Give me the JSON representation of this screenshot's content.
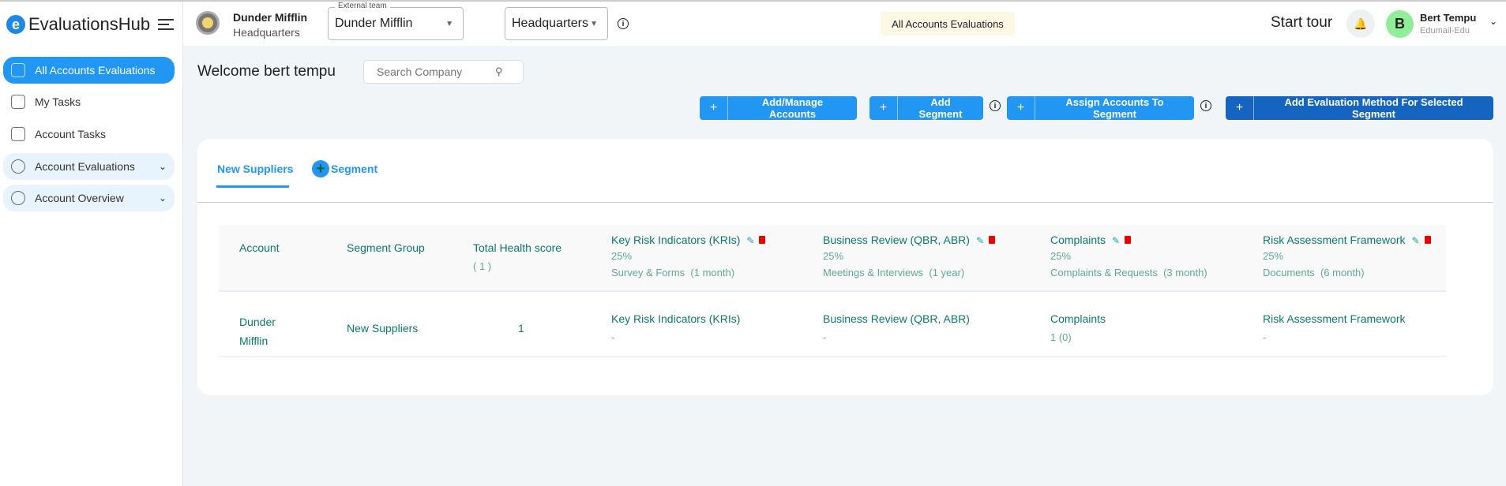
{
  "app": {
    "name": "EvaluationsHub"
  },
  "sidebar": {
    "items": [
      {
        "label": "All Accounts Evaluations"
      },
      {
        "label": "My Tasks"
      },
      {
        "label": "Account Tasks"
      },
      {
        "label": "Account Evaluations"
      },
      {
        "label": "Account Overview"
      }
    ]
  },
  "header": {
    "company": "Dunder Mifflin",
    "location": "Headquarters",
    "team_legend": "External team",
    "team_value": "Dunder Mifflin",
    "branch_value": "Headquarters",
    "badge": "All Accounts Evaluations",
    "start_tour": "Start tour",
    "user_initial": "B",
    "user_name": "Bert Tempu",
    "user_org": "Edumail-Edu"
  },
  "main": {
    "welcome": "Welcome bert tempu",
    "search_placeholder": "Search Company",
    "buttons": [
      "Add/Manage Accounts",
      "Add Segment",
      "Assign Accounts To Segment",
      "Add Evaluation Method For Selected Segment"
    ],
    "tabs": {
      "active": "New Suppliers",
      "add": "Segment"
    },
    "table": {
      "headers": {
        "account": "Account",
        "segment": "Segment Group",
        "total": "Total Health score",
        "total_sub": "( 1 )"
      },
      "methods": [
        {
          "name": "Key Risk Indicators (KRIs)",
          "weight": "25%",
          "type": "Survey & Forms  (1 month)",
          "value": "-"
        },
        {
          "name": "Business Review (QBR, ABR)",
          "weight": "25%",
          "type": "Meetings & Interviews  (1 year)",
          "value": "-"
        },
        {
          "name": "Complaints",
          "weight": "25%",
          "type": "Complaints & Requests  (3 month)",
          "value": "1 (0)"
        },
        {
          "name": "Risk Assessment Framework",
          "weight": "25%",
          "type": "Documents  (6 month)",
          "value": "-"
        }
      ],
      "rows": [
        {
          "account": "Dunder Mifflin",
          "segment": "New Suppliers",
          "total": "1"
        }
      ]
    }
  }
}
